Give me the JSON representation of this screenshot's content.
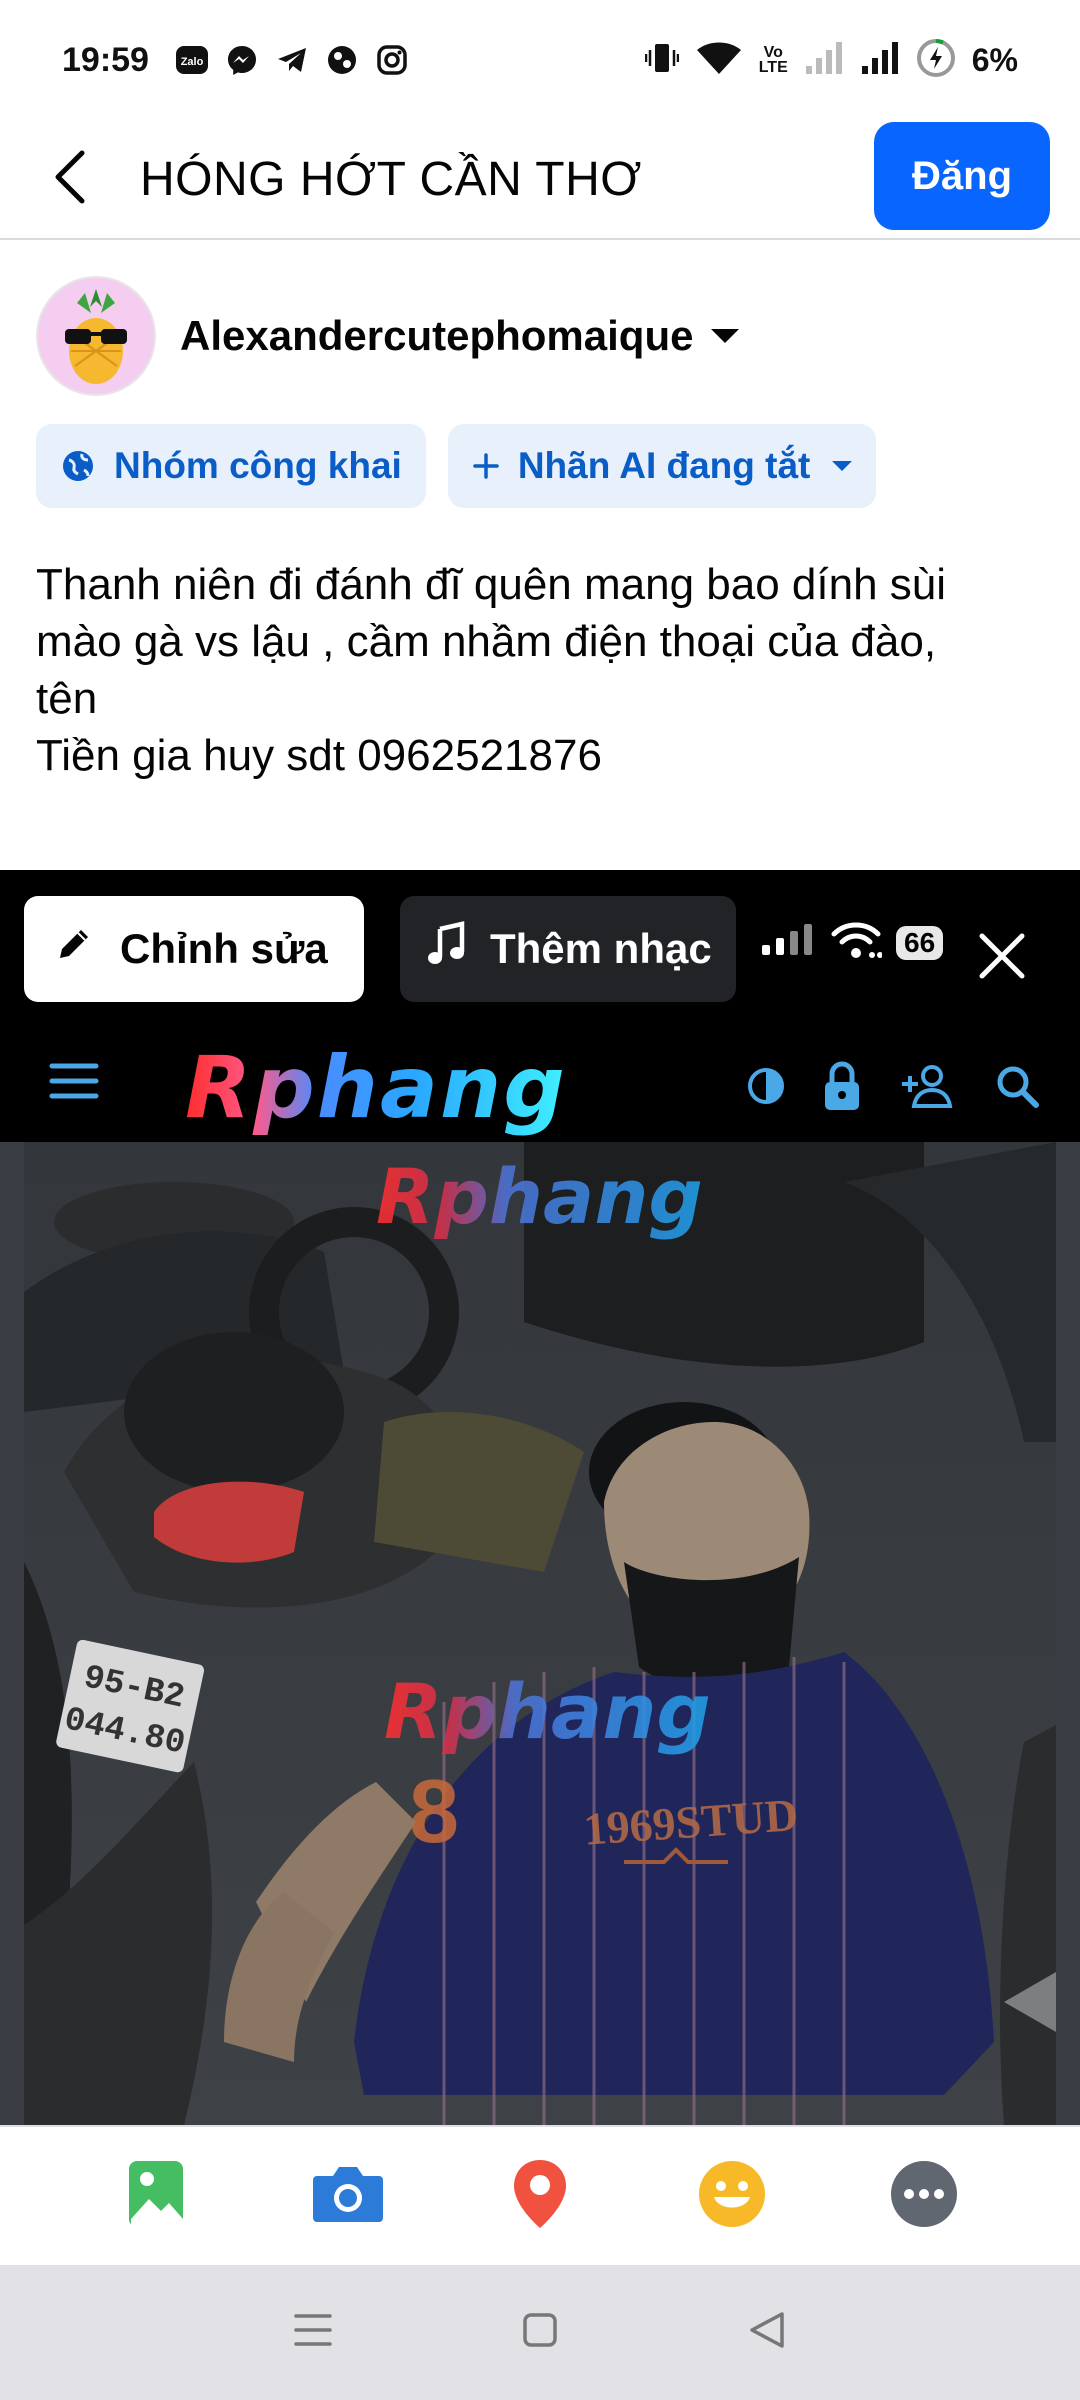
{
  "status_bar": {
    "time": "19:59",
    "apps": [
      "zalo-icon",
      "messenger-icon",
      "telegram-icon",
      "app-icon",
      "instagram-icon"
    ],
    "volte_line1": "Vo",
    "volte_line2": "LTE",
    "battery": "6%"
  },
  "header": {
    "title": "HÓNG HỚT CẦN THƠ",
    "post_label": "Đăng"
  },
  "user": {
    "name": "Alexandercutephomaique"
  },
  "chips": {
    "audience": "Nhóm công khai",
    "ai_label": "Nhãn AI đang tắt"
  },
  "post": {
    "lines": [
      "Thanh niên đi đánh đĩ quên mang bao dính sùi",
      "mào gà vs lậu , cầm nhầm điện thoại của đào,",
      "tên",
      "Tiền gia huy sdt 0962521876"
    ]
  },
  "media": {
    "edit_label": "Chỉnh sửa",
    "music_label": "Thêm nhạc",
    "inner_battery": "66",
    "site_logo": "Rphang",
    "watermark": "Rphang"
  },
  "colors": {
    "accent": "#0866ff",
    "chip_bg": "#e7f0fb",
    "chip_text": "#0a5cc7"
  }
}
